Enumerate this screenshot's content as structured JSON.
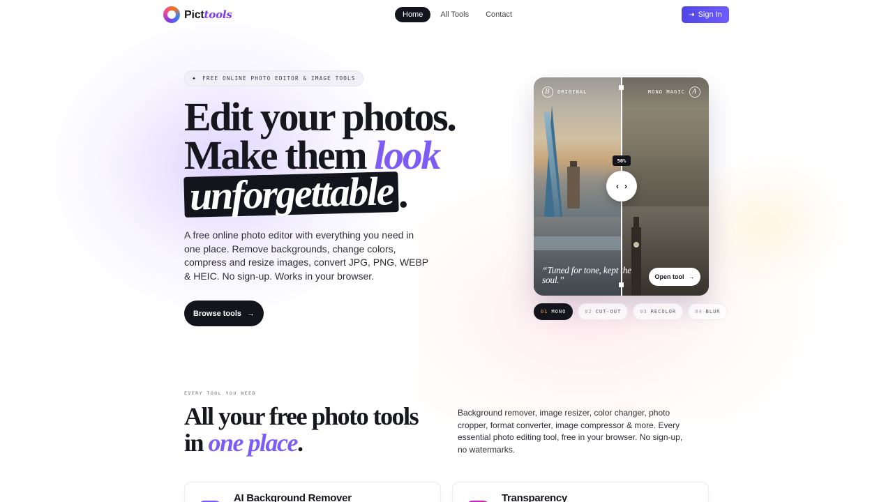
{
  "nav": {
    "logo_main": "Pict",
    "logo_accent": "tools",
    "links": [
      {
        "label": "Home",
        "active": true
      },
      {
        "label": "All Tools",
        "active": false
      },
      {
        "label": "Contact",
        "active": false
      }
    ],
    "signin_label": "Sign In"
  },
  "hero": {
    "badge": "FREE ONLINE PHOTO EDITOR & IMAGE TOOLS",
    "title_line1": "Edit your photos.",
    "title_line2_a": "Make them ",
    "title_line2_b": "look",
    "title_line3_a": "unforgettable",
    "title_line3_b": ".",
    "description": "A free online photo editor with everything you need in one place. Remove backgrounds, change colors, compress and resize images, convert JPG, PNG, WEBP & HEIC. No sign-up. Works in your browser.",
    "cta_label": "Browse tools"
  },
  "compare_card": {
    "left_letter": "B",
    "left_label": "ORIGINAL",
    "right_label": "MONO MAGIC",
    "right_letter": "A",
    "slider_percent": "50%",
    "quote": "“Tuned for tone, kept the soul.”",
    "open_tool_label": "Open tool",
    "accent_colors": {
      "purple": "#7c5cf4",
      "dark": "#14141c"
    }
  },
  "chips": [
    {
      "num": "01",
      "label": "MONO",
      "active": true
    },
    {
      "num": "02",
      "label": "CUT-OUT",
      "active": false
    },
    {
      "num": "03",
      "label": "RECOLOR",
      "active": false
    },
    {
      "num": "04",
      "label": "BLUR",
      "active": false
    }
  ],
  "section": {
    "eyebrow": "EVERY TOOL YOU NEED",
    "title_line1": "All your free photo tools",
    "title_line2_a": "in ",
    "title_line2_b": "one place",
    "title_line2_c": ".",
    "description": "Background remover, image resizer, color changer, photo cropper, format converter, image compressor & more. Every essential photo editing tool, free in your browser. No sign-up, no watermarks."
  },
  "tools": [
    {
      "name": "AI Background Remover"
    },
    {
      "name": "Transparency"
    }
  ]
}
